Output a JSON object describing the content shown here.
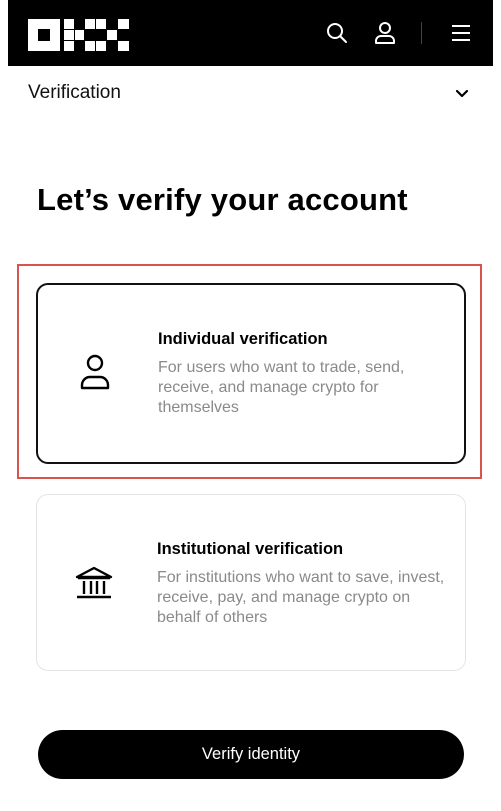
{
  "navbar": {
    "logo_text": "OKX",
    "icons": [
      "search-icon",
      "user-icon",
      "menu-icon"
    ]
  },
  "subheader": {
    "label": "Verification"
  },
  "page": {
    "title": "Let’s verify your account"
  },
  "options": [
    {
      "title": "Individual verification",
      "description": "For users who want to trade, send, receive, and manage crypto for themselves",
      "icon": "person-icon",
      "selected": true
    },
    {
      "title": "Institutional verification",
      "description": "For institutions who want to save, invest, receive, pay, and manage crypto on behalf of others",
      "icon": "bank-icon",
      "selected": false
    }
  ],
  "actions": {
    "verify_label": "Verify identity"
  },
  "colors": {
    "navbar_bg": "#000000",
    "primary": "#000000",
    "muted_text": "#8a8a8a",
    "highlight": "#d9534f"
  }
}
